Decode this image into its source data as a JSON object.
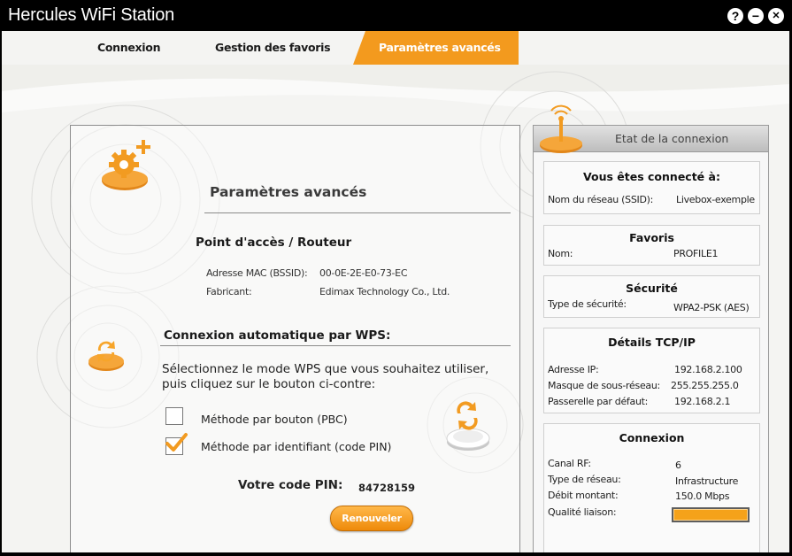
{
  "window": {
    "title": "Hercules WiFi Station",
    "help_symbol": "?",
    "minimize_symbol": "−",
    "close_symbol": "✕"
  },
  "tabs": [
    {
      "label": "Connexion",
      "active": false
    },
    {
      "label": "Gestion des favoris",
      "active": false
    },
    {
      "label": "Paramètres avancés",
      "active": true
    }
  ],
  "left": {
    "title": "Paramètres avancés",
    "access_point": {
      "heading": "Point d'accès / Routeur",
      "mac_label": "Adresse MAC (BSSID):",
      "mac_value": "00-0E-2E-E0-73-EC",
      "maker_label": "Fabricant:",
      "maker_value": "Edimax Technology Co., Ltd."
    },
    "wps": {
      "heading": "Connexion automatique par WPS:",
      "instruction_line1": "Sélectionnez le mode WPS que vous souhaitez utiliser,",
      "instruction_line2": "puis cliquez sur le bouton ci-contre:",
      "options": [
        {
          "label": "Méthode par bouton (PBC)",
          "checked": false
        },
        {
          "label": "Méthode par identifiant (code PIN)",
          "checked": true
        }
      ],
      "pin_label": "Votre code PIN:",
      "pin_value": "84728159",
      "renew_label": "Renouveler"
    }
  },
  "right": {
    "header": "Etat de la connexion",
    "connected": {
      "title": "Vous êtes connecté à:",
      "ssid_label": "Nom du réseau (SSID):",
      "ssid_value": "Livebox-exemple"
    },
    "favoris": {
      "title": "Favoris",
      "name_label": "Nom:",
      "name_value": "PROFILE1"
    },
    "securite": {
      "title": "Sécurité",
      "type_label": "Type de sécurité:",
      "type_value": "WPA2-PSK (AES)"
    },
    "tcpip": {
      "title": "Détails TCP/IP",
      "rows": [
        {
          "label": "Adresse IP:",
          "value": "192.168.2.100"
        },
        {
          "label": "Masque de sous-réseau:",
          "value": "255.255.255.0"
        },
        {
          "label": "Passerelle par défaut:",
          "value": "192.168.2.1"
        }
      ]
    },
    "connexion": {
      "title": "Connexion",
      "rows": [
        {
          "label": "Canal RF:",
          "value": "6"
        },
        {
          "label": "Type de réseau:",
          "value": "Infrastructure"
        },
        {
          "label": "Débit montant:",
          "value": "150.0 Mbps"
        }
      ],
      "quality_label": "Qualité liaison:",
      "quality_fraction": 1.0
    }
  },
  "colors": {
    "accent": "#f39a1e",
    "titlebar": "#000000",
    "background": "#f4f4f2"
  }
}
